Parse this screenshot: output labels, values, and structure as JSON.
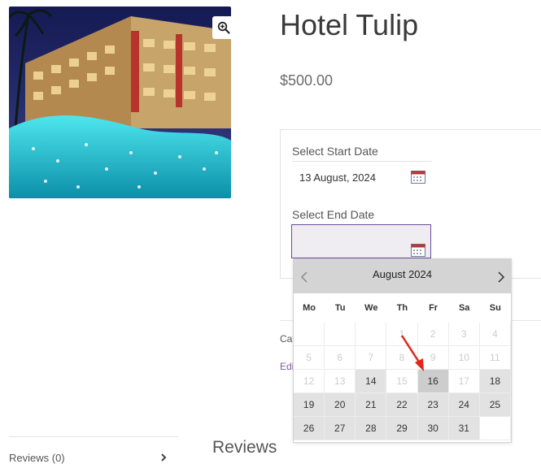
{
  "product": {
    "title": "Hotel Tulip",
    "price": "$500.00"
  },
  "booking": {
    "start_label": "Select Start Date",
    "start_value": "13 August, 2024",
    "end_label": "Select End Date",
    "end_value": ""
  },
  "meta": {
    "category_fragment": "Cat",
    "edit_fragment": "Edi"
  },
  "tabs": {
    "reviews_label": "Reviews (0)",
    "reviews_heading": "Reviews"
  },
  "calendar": {
    "month_label": "August 2024",
    "weekdays": [
      "Mo",
      "Tu",
      "We",
      "Th",
      "Fr",
      "Sa",
      "Su"
    ],
    "rows": [
      [
        {
          "d": "",
          "s": "disabled"
        },
        {
          "d": "",
          "s": "disabled"
        },
        {
          "d": "",
          "s": "disabled"
        },
        {
          "d": "1",
          "s": "disabled"
        },
        {
          "d": "2",
          "s": "disabled"
        },
        {
          "d": "3",
          "s": "disabled"
        },
        {
          "d": "4",
          "s": "disabled"
        }
      ],
      [
        {
          "d": "5",
          "s": "disabled"
        },
        {
          "d": "6",
          "s": "disabled"
        },
        {
          "d": "7",
          "s": "disabled"
        },
        {
          "d": "8",
          "s": "disabled"
        },
        {
          "d": "9",
          "s": "disabled"
        },
        {
          "d": "10",
          "s": "disabled"
        },
        {
          "d": "11",
          "s": "disabled"
        }
      ],
      [
        {
          "d": "12",
          "s": "disabled"
        },
        {
          "d": "13",
          "s": "disabled"
        },
        {
          "d": "14",
          "s": "active"
        },
        {
          "d": "15",
          "s": "disabled"
        },
        {
          "d": "16",
          "s": "hover"
        },
        {
          "d": "17",
          "s": "disabled"
        },
        {
          "d": "18",
          "s": "active"
        }
      ],
      [
        {
          "d": "19",
          "s": "active"
        },
        {
          "d": "20",
          "s": "active"
        },
        {
          "d": "21",
          "s": "active"
        },
        {
          "d": "22",
          "s": "active"
        },
        {
          "d": "23",
          "s": "active"
        },
        {
          "d": "24",
          "s": "active"
        },
        {
          "d": "25",
          "s": "active"
        }
      ],
      [
        {
          "d": "26",
          "s": "active"
        },
        {
          "d": "27",
          "s": "active"
        },
        {
          "d": "28",
          "s": "active"
        },
        {
          "d": "29",
          "s": "active"
        },
        {
          "d": "30",
          "s": "active"
        },
        {
          "d": "31",
          "s": "active"
        },
        {
          "d": "",
          "s": "empty"
        }
      ]
    ]
  },
  "colors": {
    "accent": "#6b4b9a",
    "annotation_arrow": "#e2261c"
  },
  "icons": {
    "zoom": "magnifier-plus-icon",
    "calendar": "calendar-icon",
    "prev": "chevron-left-icon",
    "next": "chevron-right-icon",
    "tab": "chevron-right-icon"
  }
}
